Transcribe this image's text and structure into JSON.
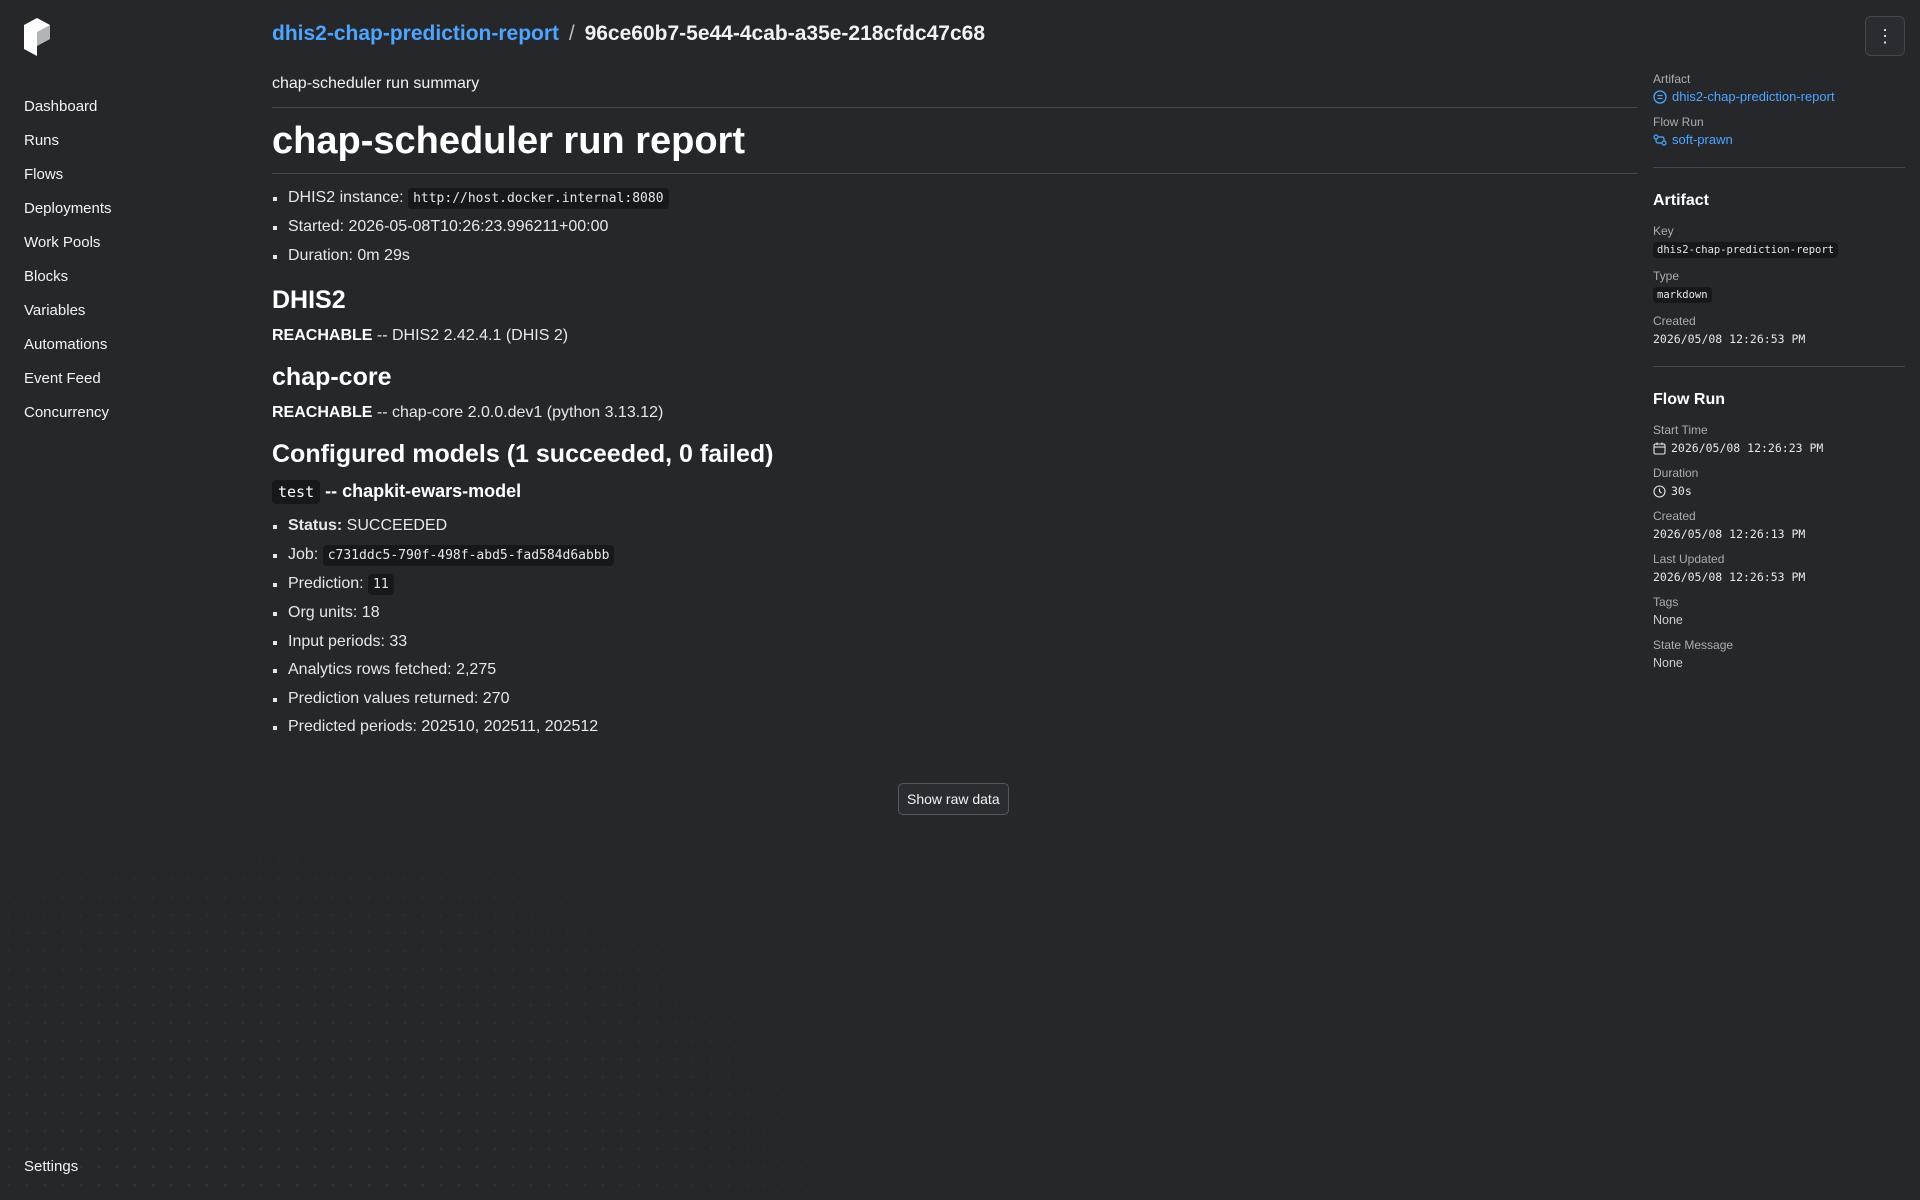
{
  "sidebar": {
    "items": [
      {
        "label": "Dashboard"
      },
      {
        "label": "Runs"
      },
      {
        "label": "Flows"
      },
      {
        "label": "Deployments"
      },
      {
        "label": "Work Pools"
      },
      {
        "label": "Blocks"
      },
      {
        "label": "Variables"
      },
      {
        "label": "Automations"
      },
      {
        "label": "Event Feed"
      },
      {
        "label": "Concurrency"
      }
    ],
    "settings_label": "Settings"
  },
  "header": {
    "artifact_link": "dhis2-chap-prediction-report",
    "separator": "/",
    "artifact_id": "96ce60b7-5e44-4cab-a35e-218cfdc47c68",
    "menu_icon": "⋮"
  },
  "report": {
    "summary_title": "chap-scheduler run summary",
    "title": "chap-scheduler run report",
    "meta": {
      "dhis2_label": "DHIS2 instance:",
      "dhis2_url": "http://host.docker.internal:8080",
      "started": "Started: 2026-05-08T10:26:23.996211+00:00",
      "duration": "Duration: 0m 29s"
    },
    "dhis2_section": {
      "heading": "DHIS2",
      "status_word": "REACHABLE",
      "status_rest": " -- DHIS2 2.42.4.1 (DHIS 2)"
    },
    "chapcore_section": {
      "heading": "chap-core",
      "status_word": "REACHABLE",
      "status_rest": " -- chap-core 2.0.0.dev1 (python 3.13.12)"
    },
    "models_heading": "Configured models (1 succeeded, 0 failed)",
    "model": {
      "code": "test",
      "name": " -- chapkit-ewars-model",
      "status_label": "Status:",
      "status_value": " SUCCEEDED",
      "job_label": "Job:",
      "job_id": "c731ddc5-790f-498f-abd5-fad584d6abbb",
      "prediction_label": "Prediction:",
      "prediction_id": "11",
      "org_units": "Org units: 18",
      "input_periods": "Input periods: 33",
      "analytics_rows": "Analytics rows fetched: 2,275",
      "prediction_values": "Prediction values returned: 270",
      "predicted_periods": "Predicted periods: 202510, 202511, 202512"
    },
    "raw_button": "Show raw data"
  },
  "right_panel": {
    "artifact_label": "Artifact",
    "artifact_link": "dhis2-chap-prediction-report",
    "flow_run_label": "Flow Run",
    "flow_run_link": "soft-prawn",
    "artifact_section": {
      "heading": "Artifact",
      "key_label": "Key",
      "key_value": "dhis2-chap-prediction-report",
      "type_label": "Type",
      "type_value": "markdown",
      "created_label": "Created",
      "created_value": "2026/05/08 12:26:53 PM"
    },
    "flow_run_section": {
      "heading": "Flow Run",
      "start_label": "Start Time",
      "start_value": "2026/05/08 12:26:23 PM",
      "duration_label": "Duration",
      "duration_value": "30s",
      "created_label": "Created",
      "created_value": "2026/05/08 12:26:13 PM",
      "updated_label": "Last Updated",
      "updated_value": "2026/05/08 12:26:53 PM",
      "tags_label": "Tags",
      "tags_value": "None",
      "state_label": "State Message",
      "state_value": "None"
    }
  },
  "colors": {
    "background": "#25272b",
    "link": "#4ea5ff",
    "code_bg": "#17181b"
  }
}
